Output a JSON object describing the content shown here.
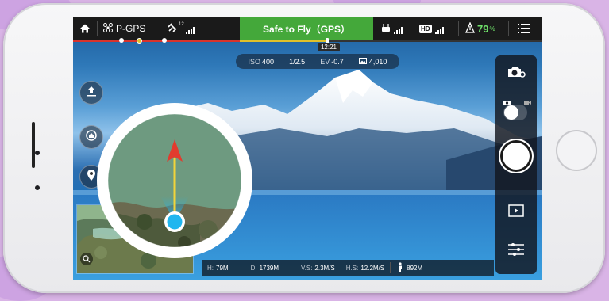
{
  "topbar": {
    "home_icon": "home-icon",
    "flight_mode": "P-GPS",
    "drone_icon": "drone-icon",
    "gps_icon": "satellite-icon",
    "gps_count": "12",
    "status_text": "Safe to Fly（GPS）",
    "rc_icon": "remote-controller-icon",
    "hd_label": "HD",
    "battery_percent": "79",
    "battery_unit": "%",
    "menu_icon": "menu-icon"
  },
  "timeline": {
    "time_label": "12:21"
  },
  "exposure": {
    "iso_label": "ISO",
    "iso_value": "400",
    "shutter_value": "1/2.5",
    "ev_label": "EV",
    "ev_value": "-0.7",
    "storage_icon": "photo-storage-icon",
    "storage_value": "4,010"
  },
  "left_controls": [
    {
      "name": "auto-takeoff-icon"
    },
    {
      "name": "return-home-icon"
    },
    {
      "name": "waypoint-icon"
    }
  ],
  "minimap": {
    "zoom_icon": "zoom-icon"
  },
  "right_panel": {
    "camera_settings_icon": "camera-settings-icon",
    "photo_icon": "photo-icon",
    "video_icon": "video-icon",
    "playback_icon": "playback-icon",
    "settings_icon": "sliders-icon"
  },
  "telemetry": {
    "height_label": "H:",
    "height_value": "79M",
    "distance_label": "D:",
    "distance_value": "1739M",
    "vs_label": "V.S:",
    "vs_value": "2.3M/S",
    "hs_label": "H.S:",
    "hs_value": "12.2M/S",
    "home_dist_value": "892M"
  },
  "colors": {
    "safe_green": "#44a83a",
    "battery_green": "#6fe06a",
    "timeline_red": "#d8332c",
    "timeline_yellow": "#e0c12a",
    "aircraft_red": "#e23b2e",
    "heading_yellow": "#f2d43a",
    "user_blue": "#1fb6ef"
  }
}
